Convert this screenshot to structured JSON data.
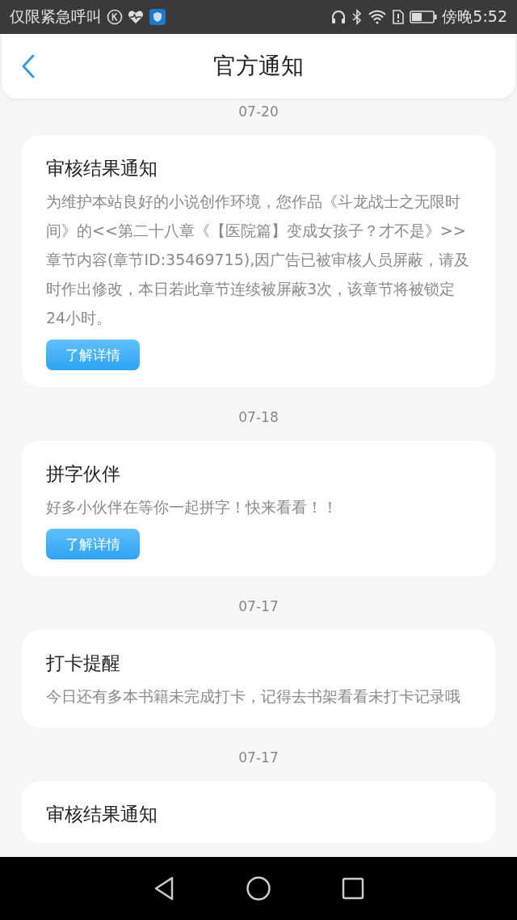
{
  "status_bar": {
    "carrier": "仅限紧急呼叫",
    "time": "傍晚5:52"
  },
  "header": {
    "title": "官方通知"
  },
  "notices": [
    {
      "date": "07-20",
      "title": "审核结果通知",
      "body": "为维护本站良好的小说创作环境，您作品《斗龙战士之无限时间》的<<第二十八章《【医院篇】变成女孩子？才不是》>>章节内容(章节ID:35469715),因广告已被审核人员屏蔽，请及时作出修改，本日若此章节连续被屏蔽3次，该章节将被锁定24小时。",
      "button": "了解详情"
    },
    {
      "date": "07-18",
      "title": "拼字伙伴",
      "body": "好多小伙伴在等你一起拼字！快来看看！！",
      "button": "了解详情"
    },
    {
      "date": "07-17",
      "title": "打卡提醒",
      "body": "今日还有多本书籍未完成打卡，记得去书架看看未打卡记录哦"
    },
    {
      "date": "07-17",
      "title": "审核结果通知"
    }
  ]
}
